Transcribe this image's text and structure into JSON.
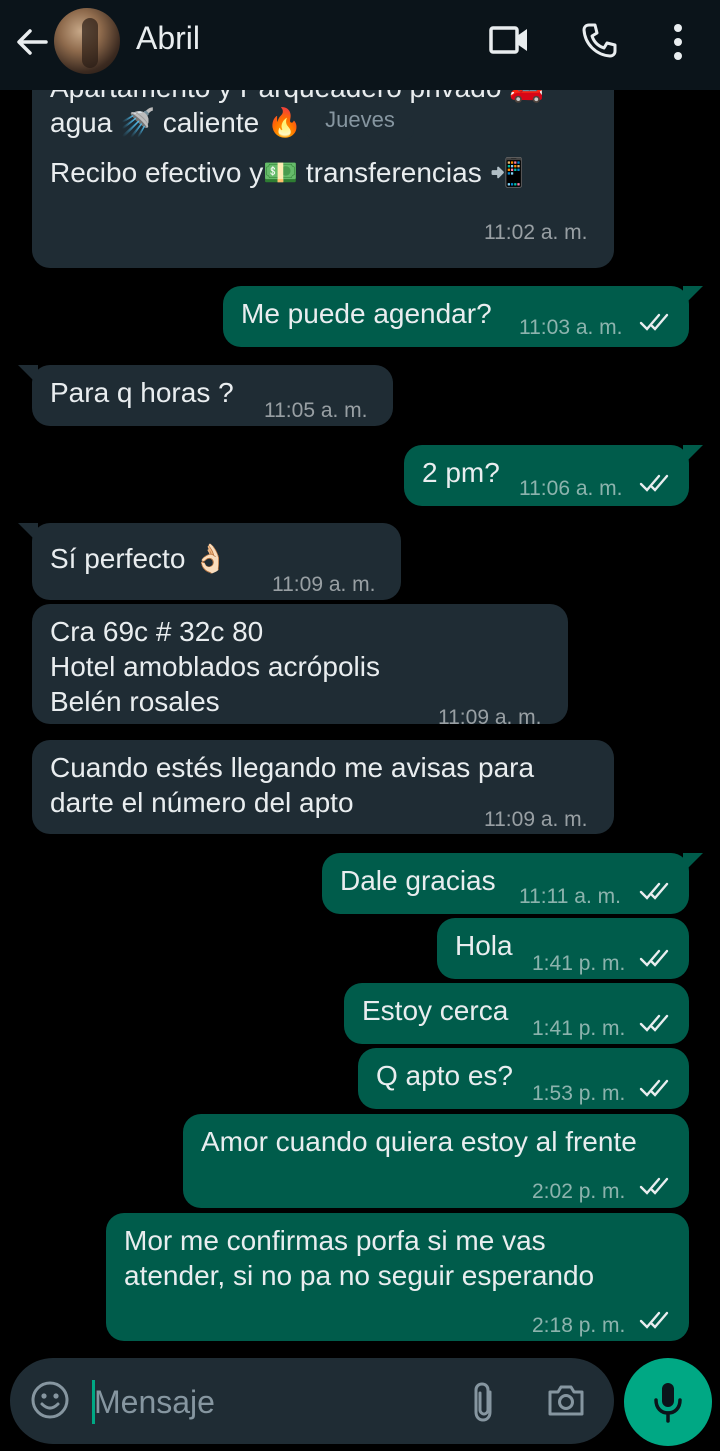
{
  "header": {
    "contact_name": "Abril"
  },
  "day_chip": "Jueves",
  "messages": [
    {
      "dir": "in",
      "lines": [
        "Apartamento y Parqueadero privado 🚗",
        "agua 🚿 caliente 🔥",
        "Recibo efectivo y💵 transferencias 📲"
      ],
      "time": "11:02 a. m."
    },
    {
      "dir": "out",
      "lines": [
        "Me puede agendar?"
      ],
      "time": "11:03 a. m."
    },
    {
      "dir": "in",
      "lines": [
        "Para q horas ?"
      ],
      "time": "11:05 a. m."
    },
    {
      "dir": "out",
      "lines": [
        "2 pm?"
      ],
      "time": "11:06 a. m."
    },
    {
      "dir": "in",
      "lines": [
        "Sí perfecto 👌🏻"
      ],
      "time": "11:09 a. m."
    },
    {
      "dir": "in",
      "lines": [
        "Cra 69c # 32c 80",
        "Hotel amoblados acrópolis",
        "Belén rosales"
      ],
      "time": "11:09 a. m."
    },
    {
      "dir": "in",
      "lines": [
        "Cuando estés llegando me avisas para",
        "darte el número del apto"
      ],
      "time": "11:09 a. m."
    },
    {
      "dir": "out",
      "lines": [
        "Dale gracias"
      ],
      "time": "11:11 a. m."
    },
    {
      "dir": "out",
      "lines": [
        "Hola"
      ],
      "time": "1:41 p. m."
    },
    {
      "dir": "out",
      "lines": [
        "Estoy cerca"
      ],
      "time": "1:41 p. m."
    },
    {
      "dir": "out",
      "lines": [
        "Q apto es?"
      ],
      "time": "1:53 p. m."
    },
    {
      "dir": "out",
      "lines": [
        "Amor cuando quiera estoy al frente"
      ],
      "time": "2:02 p. m."
    },
    {
      "dir": "out",
      "lines": [
        "Mor me confirmas porfa si me vas",
        "atender, si no pa no seguir esperando"
      ],
      "time": "2:18 p. m."
    }
  ],
  "composer": {
    "placeholder": "Mensaje"
  },
  "colors": {
    "incoming_bubble": "#1f2c34",
    "outgoing_bubble": "#005c4b",
    "accent": "#00a884",
    "read_ticks": "#e9edef"
  }
}
